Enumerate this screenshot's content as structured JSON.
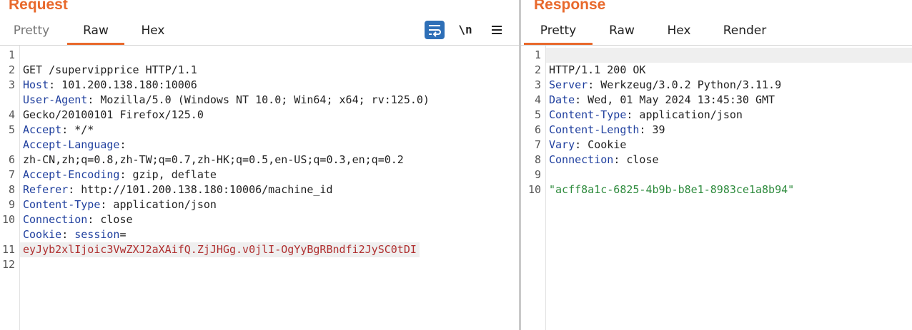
{
  "request": {
    "title": "Request",
    "tabs": [
      "Pretty",
      "Raw",
      "Hex"
    ],
    "active_tab": "Raw",
    "tools": {
      "wrap_icon": "word-wrap-icon",
      "newline_label": "\\n",
      "menu_icon": "hamburger-menu-icon"
    },
    "line_numbers": [
      "1",
      "2",
      "3",
      "4",
      "5",
      "6",
      "7",
      "8",
      "9",
      "10",
      "11",
      "12"
    ],
    "lines": {
      "l1": "GET /supervipprice HTTP/1.1",
      "l2_key": "Host",
      "l2_val": ": 101.200.138.180:10006",
      "l3_key": "User-Agent",
      "l3_val": ": Mozilla/5.0 (Windows NT 10.0; Win64; x64; rv:125.0)",
      "l3_cont": "Gecko/20100101 Firefox/125.0",
      "l4_key": "Accept",
      "l4_val": ": */*",
      "l5_key": "Accept-Language",
      "l5_val": ":",
      "l5_cont": "zh-CN,zh;q=0.8,zh-TW;q=0.7,zh-HK;q=0.5,en-US;q=0.3,en;q=0.2",
      "l6_key": "Accept-Encoding",
      "l6_val": ": gzip, deflate",
      "l7_key": "Referer",
      "l7_val": ": http://101.200.138.180:10006/machine_id",
      "l8_key": "Content-Type",
      "l8_val": ": application/json",
      "l9_key": "Connection",
      "l9_val": ": close",
      "l10_key": "Cookie",
      "l10_sep": ": ",
      "l10_name": "session",
      "l10_eq": "=",
      "l10_cont": "eyJyb2xlIjoic3VwZXJ2aXAifQ.ZjJHGg.v0jlI-OgYyBgRBndfi2JySC0tDI"
    }
  },
  "response": {
    "title": "Response",
    "tabs": [
      "Pretty",
      "Raw",
      "Hex",
      "Render"
    ],
    "active_tab": "Pretty",
    "line_numbers": [
      "1",
      "2",
      "3",
      "4",
      "5",
      "6",
      "7",
      "8",
      "9",
      "10"
    ],
    "lines": {
      "l1": "HTTP/1.1 200 OK",
      "l2_key": "Server",
      "l2_val": ": Werkzeug/3.0.2 Python/3.11.9",
      "l3_key": "Date",
      "l3_val": ": Wed, 01 May 2024 13:45:30 GMT",
      "l4_key": "Content-Type",
      "l4_val": ": application/json",
      "l5_key": "Content-Length",
      "l5_val": ": 39",
      "l6_key": "Vary",
      "l6_val": ": Cookie",
      "l7_key": "Connection",
      "l7_val": ": close",
      "l9": "\"acff8a1c-6825-4b9b-b8e1-8983ce1a8b94\""
    }
  },
  "colors": {
    "accent": "#e8692c",
    "header_key": "#1f3f9e",
    "cookie_value": "#b03030",
    "json_string": "#2e8b3d"
  }
}
